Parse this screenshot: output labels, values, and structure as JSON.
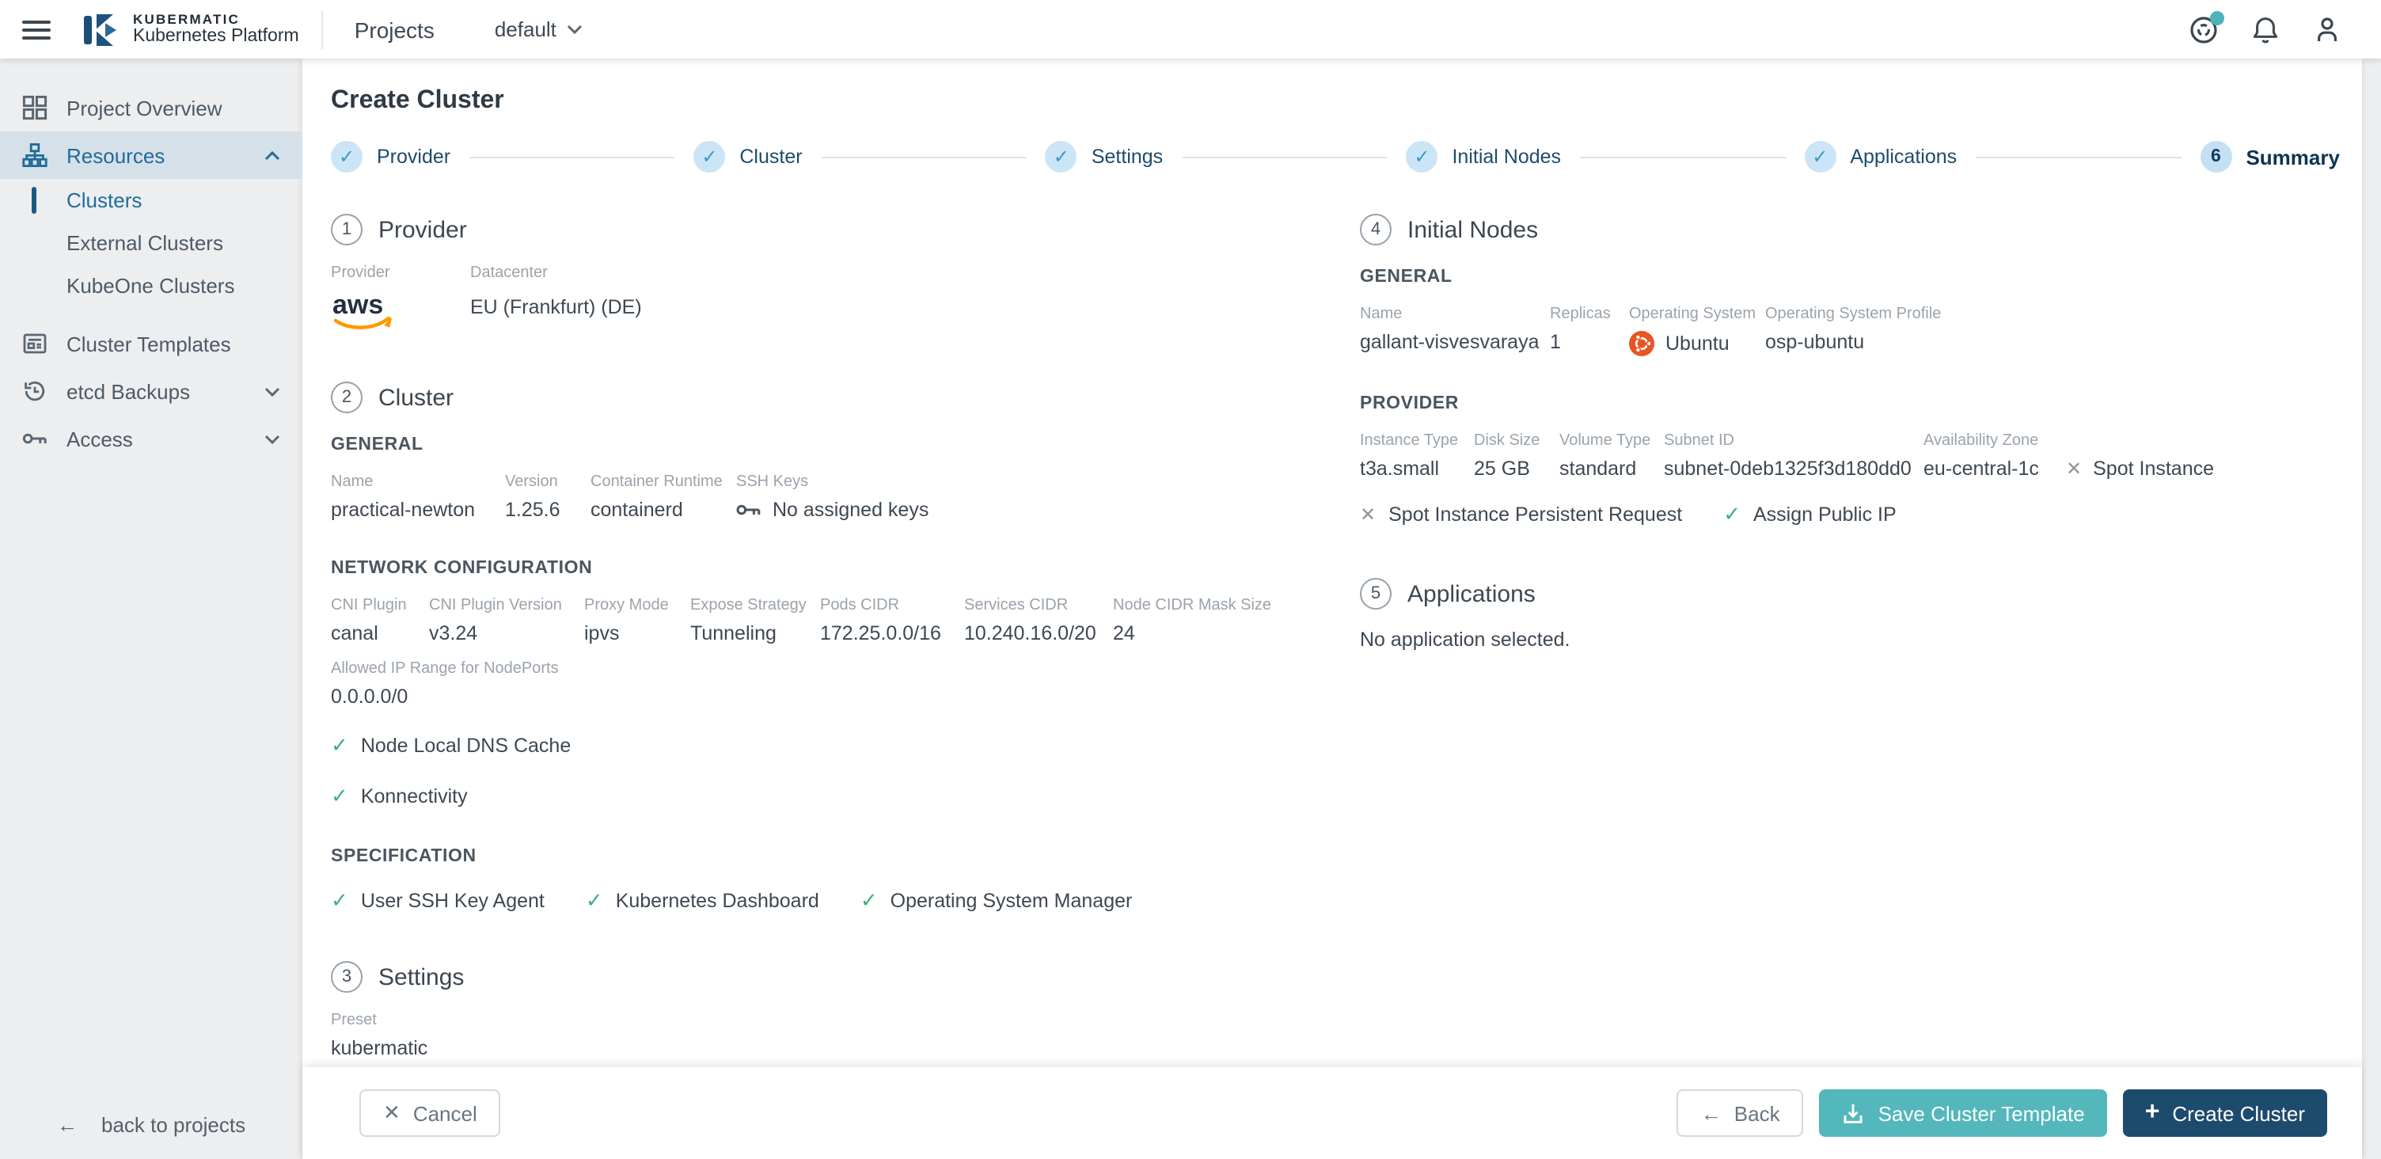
{
  "colors": {
    "accent_teal": "#53b7bb",
    "primary_navy": "#1d4b6d",
    "active_blue": "#1f6c99",
    "green_check": "#3fb077",
    "ubuntu_orange": "#e95420",
    "aws_orange": "#ff9900",
    "step_circle_blue": "#cbe5f7",
    "sidebar_bg": "#edeef0"
  },
  "icons": {
    "check": "✓",
    "cross": "✕",
    "plus": "+",
    "arrow-left": "←"
  },
  "header": {
    "brand_top": "KUBERMATIC",
    "brand_bottom": "Kubernetes Platform",
    "section": "Projects",
    "project": "default"
  },
  "sidebar": {
    "project_overview": "Project Overview",
    "resources": "Resources",
    "clusters": "Clusters",
    "external_clusters": "External Clusters",
    "kubeone_clusters": "KubeOne Clusters",
    "cluster_templates": "Cluster Templates",
    "etcd_backups": "etcd Backups",
    "access": "Access",
    "back": "back to projects"
  },
  "wizard": {
    "title": "Create Cluster",
    "steps": [
      {
        "label": "Provider"
      },
      {
        "label": "Cluster"
      },
      {
        "label": "Settings"
      },
      {
        "label": "Initial Nodes"
      },
      {
        "label": "Applications"
      },
      {
        "label": "Summary",
        "number": "6"
      }
    ]
  },
  "provider_section": {
    "number": "1",
    "title": "Provider",
    "provider_label": "Provider",
    "provider_value": "aws",
    "datacenter_label": "Datacenter",
    "datacenter_value": "EU (Frankfurt) (DE)"
  },
  "cluster_section": {
    "number": "2",
    "title": "Cluster",
    "general_heading": "GENERAL",
    "general": [
      {
        "label": "Name",
        "value": "practical-newton"
      },
      {
        "label": "Version",
        "value": "1.25.6"
      },
      {
        "label": "Container Runtime",
        "value": "containerd"
      },
      {
        "label": "SSH Keys",
        "value": "No assigned keys"
      }
    ],
    "network_heading": "NETWORK CONFIGURATION",
    "network": [
      {
        "label": "CNI Plugin",
        "value": "canal"
      },
      {
        "label": "CNI Plugin Version",
        "value": "v3.24"
      },
      {
        "label": "Proxy Mode",
        "value": "ipvs"
      },
      {
        "label": "Expose Strategy",
        "value": "Tunneling"
      },
      {
        "label": "Pods CIDR",
        "value": "172.25.0.0/16"
      },
      {
        "label": "Services CIDR",
        "value": "10.240.16.0/20"
      },
      {
        "label": "Node CIDR Mask Size",
        "value": "24"
      }
    ],
    "allowed_ip": {
      "label": "Allowed IP Range for NodePorts",
      "value": "0.0.0.0/0"
    },
    "checks": [
      "Node Local DNS Cache",
      "Konnectivity"
    ],
    "spec_heading": "SPECIFICATION",
    "spec_checks": [
      "User SSH Key Agent",
      "Kubernetes Dashboard",
      "Operating System Manager"
    ]
  },
  "settings_section": {
    "number": "3",
    "title": "Settings",
    "preset_label": "Preset",
    "preset_value": "kubermatic"
  },
  "nodes_section": {
    "number": "4",
    "title": "Initial Nodes",
    "general_heading": "GENERAL",
    "general": [
      {
        "label": "Name",
        "value": "gallant-visvesvaraya"
      },
      {
        "label": "Replicas",
        "value": "1"
      },
      {
        "label": "Operating System",
        "value": "Ubuntu"
      },
      {
        "label": "Operating System Profile",
        "value": "osp-ubuntu"
      }
    ],
    "provider_heading": "PROVIDER",
    "provider": [
      {
        "label": "Instance Type",
        "value": "t3a.small"
      },
      {
        "label": "Disk Size",
        "value": "25 GB"
      },
      {
        "label": "Volume Type",
        "value": "standard"
      },
      {
        "label": "Subnet ID",
        "value": "subnet-0deb1325f3d180dd0"
      },
      {
        "label": "Availability Zone",
        "value": "eu-central-1c"
      }
    ],
    "spot_instance": "Spot Instance",
    "spot_persistent": "Spot Instance Persistent Request",
    "assign_public_ip": "Assign Public IP"
  },
  "apps_section": {
    "number": "5",
    "title": "Applications",
    "empty": "No application selected."
  },
  "footer": {
    "cancel": "Cancel",
    "back": "Back",
    "save_template": "Save Cluster Template",
    "create": "Create Cluster"
  }
}
